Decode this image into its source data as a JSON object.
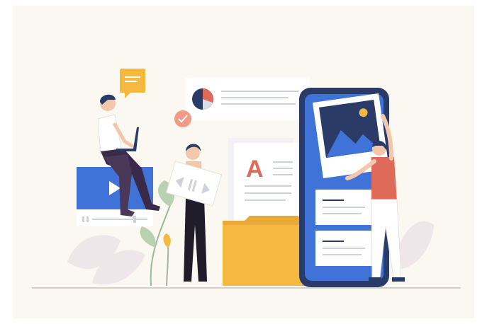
{
  "illustration": {
    "kind": "flat vector illustration",
    "elements": [
      "chat-bubble-icon",
      "pie-chart-card",
      "checkmark-badge-icon",
      "video-player-card",
      "play-icon",
      "document-card",
      "letter-a-glyph",
      "folder-icon",
      "smartphone",
      "photo-card",
      "mountain-image-icon",
      "sun-icon",
      "text-cards",
      "leaf-decorations",
      "three-people"
    ],
    "document_letter": "A",
    "colors": {
      "background": "#fbf7f1",
      "blue": "#3f73d8",
      "dark_navy": "#2b3b67",
      "orange_yellow": "#f5b942",
      "coral": "#e06a5a",
      "leaf_pink": "#efe6ea",
      "leaf_green": "#b9d1b0",
      "white": "#ffffff"
    }
  }
}
